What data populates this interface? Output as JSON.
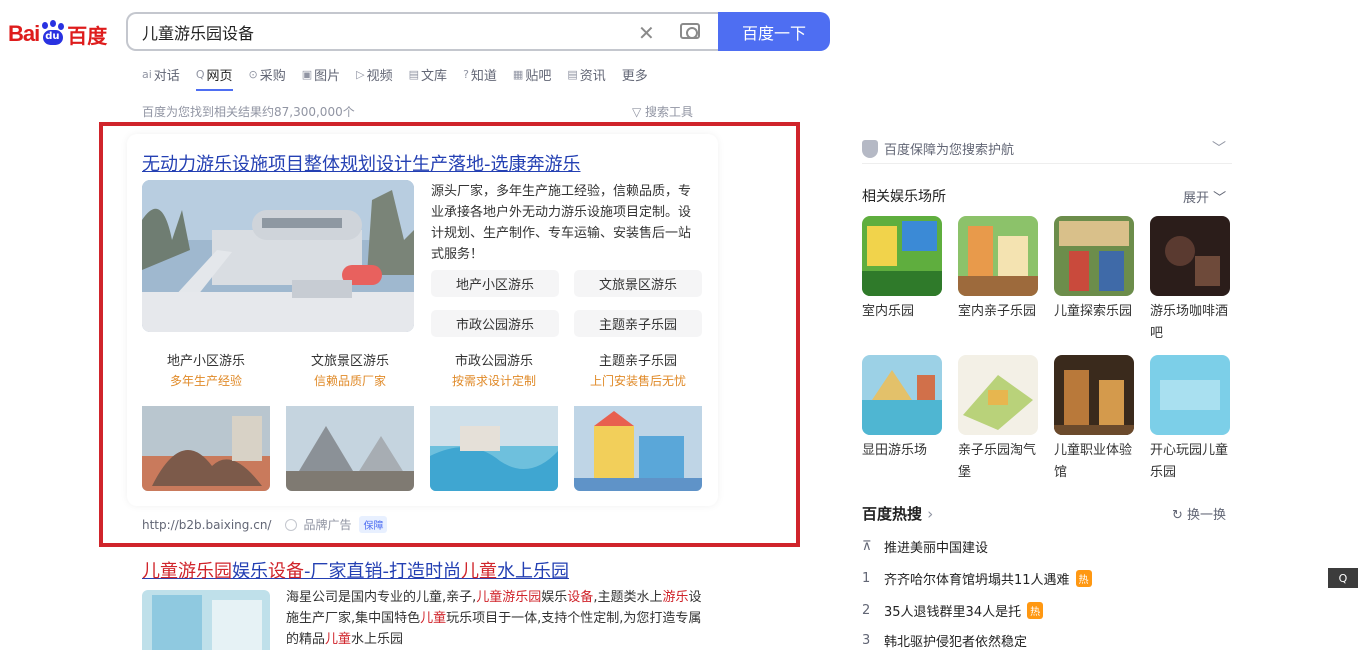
{
  "logo": {
    "latin": "Bai",
    "paw": "du",
    "cn": "百度"
  },
  "search": {
    "query": "儿童游乐园设备",
    "button": "百度一下"
  },
  "tabs": [
    {
      "icon": "ai",
      "label": "对话"
    },
    {
      "icon": "Q",
      "label": "网页"
    },
    {
      "icon": "⊙",
      "label": "采购"
    },
    {
      "icon": "▣",
      "label": "图片"
    },
    {
      "icon": "▷",
      "label": "视频"
    },
    {
      "icon": "▤",
      "label": "文库"
    },
    {
      "icon": "?",
      "label": "知道"
    },
    {
      "icon": "▦",
      "label": "贴吧"
    },
    {
      "icon": "▤",
      "label": "资讯"
    },
    {
      "icon": "",
      "label": "更多"
    }
  ],
  "result_count": "百度为您找到相关结果约87,300,000个",
  "search_tools": "搜索工具",
  "ad": {
    "title": "无动力游乐设施项目整体规划设计生产落地-选康奔游乐",
    "desc": "源头厂家，多年生产施工经验，信赖品质，专业承接各地户外无动力游乐设施项目定制。设计规划、生产制作、专车运输、安装售后一站式服务！",
    "chips": [
      "地产小区游乐",
      "文旅景区游乐",
      "市政公园游乐",
      "主题亲子乐园"
    ],
    "sub_cards": [
      {
        "title": "地产小区游乐",
        "sub": "多年生产经验"
      },
      {
        "title": "文旅景区游乐",
        "sub": "信赖品质厂家"
      },
      {
        "title": "市政公园游乐",
        "sub": "按需求设计定制"
      },
      {
        "title": "主题亲子乐园",
        "sub": "上门安装售后无忧"
      }
    ],
    "url": "http://b2b.baixing.cn/",
    "brand_label": "品牌广告",
    "guard_label": "保障"
  },
  "result2": {
    "title_parts": [
      "儿童游乐园",
      "娱乐",
      "设备",
      "-厂家直销-打造时尚",
      "儿童",
      "水上乐园"
    ],
    "desc_line1": "海星公司是国内专业的儿童,亲子,",
    "desc_hl1": "儿童游乐园",
    "desc_mid1": "娱乐",
    "desc_hl2": "设备",
    "desc_mid2": ",主题类水上",
    "desc_hl3": "游乐",
    "desc_mid3": "设施生产厂家,集中国特色",
    "desc_hl4": "儿童",
    "desc_mid4": "玩乐项目于一体,支持个性定制,为您打造专属的精品",
    "desc_hl5": "儿童",
    "desc_end": "水上乐园"
  },
  "sidebar": {
    "guard": "百度保障为您搜索护航",
    "related_title": "相关娱乐场所",
    "expand": "展开",
    "places": [
      {
        "name": "室内乐园"
      },
      {
        "name": "室内亲子乐园"
      },
      {
        "name": "儿童探索乐园"
      },
      {
        "name": "游乐场咖啡酒吧"
      },
      {
        "name": "显田游乐场"
      },
      {
        "name": "亲子乐园淘气堡"
      },
      {
        "name": "儿童职业体验馆"
      },
      {
        "name": "开心玩园儿童乐园"
      }
    ],
    "hot_title": "百度热搜",
    "hot_refresh": "换一换",
    "hot": [
      {
        "num": "",
        "text": "推进美丽中国建设",
        "badge": ""
      },
      {
        "num": "1",
        "text": "齐齐哈尔体育馆坍塌共11人遇难",
        "badge": "热"
      },
      {
        "num": "2",
        "text": "35人退钱群里34人是托",
        "badge": "热"
      },
      {
        "num": "3",
        "text": "韩北驱护侵犯者依然稳定",
        "badge": ""
      }
    ]
  },
  "edge_badge": "Q"
}
